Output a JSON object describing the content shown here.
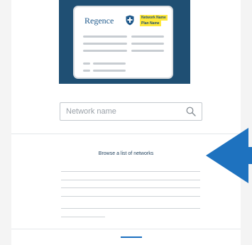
{
  "illustration": {
    "brand": "Regence",
    "network_tag": "Network Name",
    "plan_tag": "Plan Name"
  },
  "search": {
    "placeholder": "Network name"
  },
  "browse": {
    "link_label": "Browse a list of networks"
  },
  "colors": {
    "illustration_bg": "#1f4f73",
    "highlight": "#ffe83a",
    "arrow": "#1e72bf",
    "accent": "#1b6fc0"
  }
}
